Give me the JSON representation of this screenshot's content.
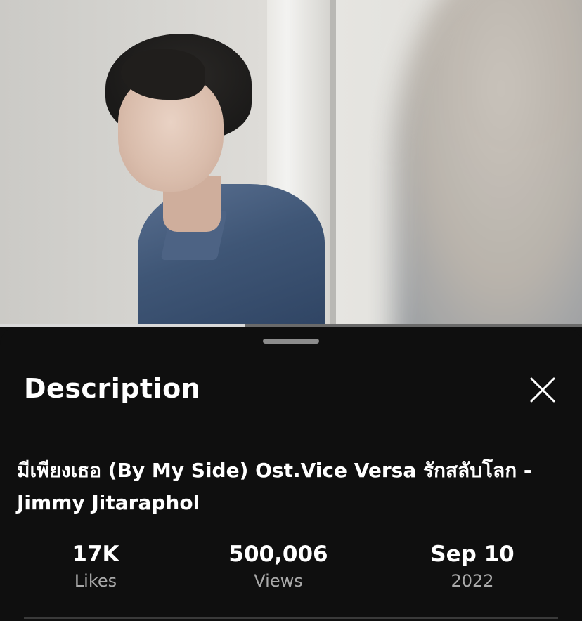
{
  "player": {
    "progress_fraction": 0.42
  },
  "panel": {
    "title": "Description",
    "close_icon": "close-icon"
  },
  "video": {
    "title": "มีเพียงเธอ (By My Side) Ost.Vice Versa รักสลับโลก - Jimmy Jitaraphol"
  },
  "stats": [
    {
      "value": "17K",
      "label": "Likes"
    },
    {
      "value": "500,006",
      "label": "Views"
    },
    {
      "value": "Sep 10",
      "label": "2022"
    }
  ],
  "colors": {
    "background": "#0f0f0f",
    "text_primary": "#ffffff",
    "text_secondary": "#aaaaaa",
    "divider": "#3a3a3a"
  }
}
